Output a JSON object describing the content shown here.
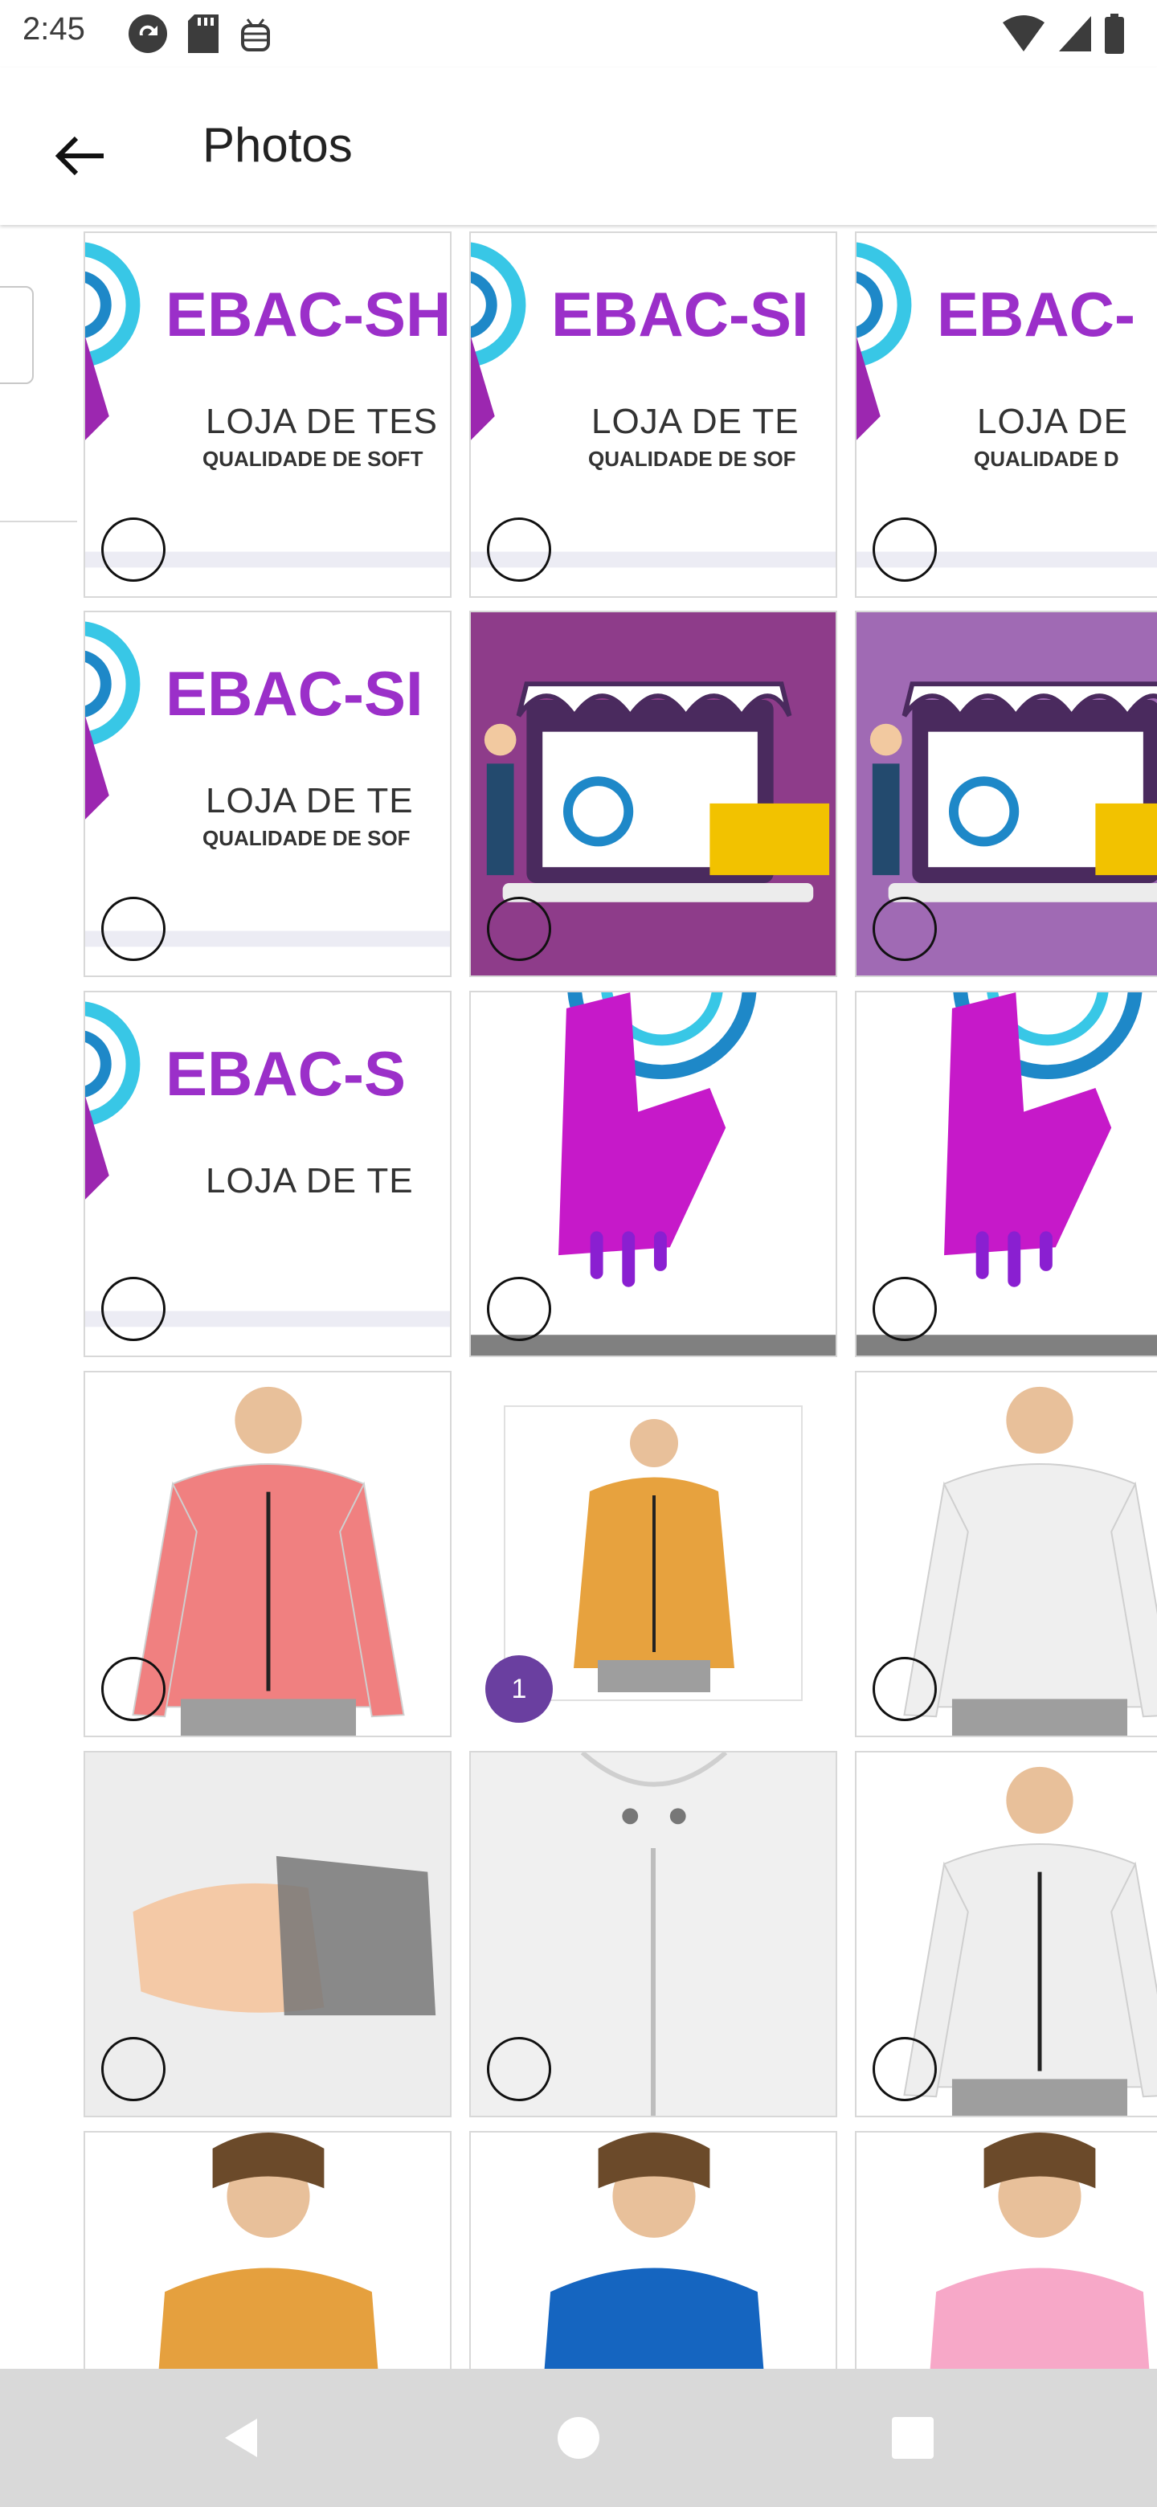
{
  "status_bar": {
    "time": "2:45",
    "left_icons": [
      "sync-icon",
      "sd-card-icon",
      "android-debug-icon"
    ],
    "right_icons": [
      "wifi-icon",
      "cellular-signal-icon",
      "battery-icon"
    ]
  },
  "app_bar": {
    "title": "Photos",
    "back_icon": "arrow-back-icon"
  },
  "grid": {
    "tiles": [
      {
        "name": "ebac-shop-logo-photo",
        "kind": "banner",
        "logo_text": "EBAC-SH",
        "line1": "LOJA DE TES",
        "line2": "QUALIDADE DE SOFT",
        "selected": false
      },
      {
        "name": "ebac-shop-logo-photo",
        "kind": "banner",
        "logo_text": "EBAC-SI",
        "line1": "LOJA DE TE",
        "line2": "QUALIDADE DE SOF",
        "selected": false
      },
      {
        "name": "ebac-shop-logo-photo",
        "kind": "banner",
        "logo_text": "EBAC-",
        "line1": "LOJA DE",
        "line2": "QUALIDADE D",
        "selected": false
      },
      {
        "name": "ebac-shop-logo-photo",
        "kind": "banner",
        "logo_text": "EBAC-SI",
        "line1": "LOJA DE TE",
        "line2": "QUALIDADE DE SOF",
        "selected": false
      },
      {
        "name": "store-laptop-illustration-photo",
        "kind": "store",
        "bg": "#8e3c8a",
        "selected": false
      },
      {
        "name": "store-laptop-illustration-photo",
        "kind": "store",
        "bg": "#a06ab4",
        "selected": false
      },
      {
        "name": "ebac-shop-logo-photo",
        "kind": "banner",
        "logo_text": "EBAC-S",
        "line1": "LOJA DE TE",
        "line2": "",
        "selected": false
      },
      {
        "name": "hand-logo-photo",
        "kind": "hand",
        "selected": false
      },
      {
        "name": "hand-logo-photo",
        "kind": "hand",
        "selected": false
      },
      {
        "name": "pink-jacket-photo",
        "kind": "jacket",
        "color": "#f08080",
        "selected": false
      },
      {
        "name": "orange-jacket-photo",
        "kind": "jacket-small",
        "color": "#e7a23e",
        "selected": true,
        "badge": "1"
      },
      {
        "name": "white-jacket-back-photo",
        "kind": "jacket-back",
        "color": "#efefef",
        "selected": false
      },
      {
        "name": "white-jacket-sleeve-photo",
        "kind": "sleeve",
        "color": "#ededed",
        "selected": false
      },
      {
        "name": "white-jacket-detail-photo",
        "kind": "detail",
        "color": "#f0f0f0",
        "selected": false
      },
      {
        "name": "white-jacket-photo",
        "kind": "jacket",
        "color": "#eeeeee",
        "selected": false
      },
      {
        "name": "orange-pullover-photo",
        "kind": "pullover",
        "color": "#e5a03e",
        "selected": false
      },
      {
        "name": "blue-pullover-photo",
        "kind": "pullover",
        "color": "#1565c0",
        "selected": false
      },
      {
        "name": "pink-pullover-photo",
        "kind": "pullover",
        "color": "#f7a8c8",
        "selected": false
      }
    ]
  },
  "nav_bar": {
    "buttons": [
      "back-triangle-icon",
      "home-circle-icon",
      "recents-square-icon"
    ]
  },
  "colors": {
    "accent": "#6a3fa0",
    "ebac_purple": "#9b2fc9",
    "nav_bg": "#d9d9d9"
  }
}
